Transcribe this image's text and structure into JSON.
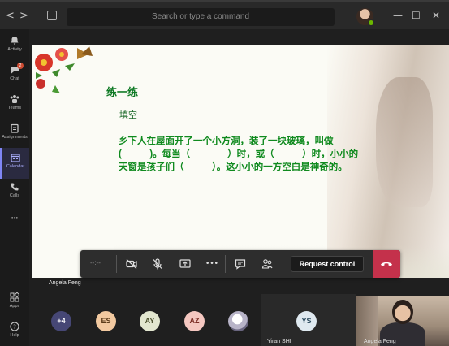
{
  "titlebar": {
    "search_placeholder": "Search or type a command",
    "back_glyph": "<",
    "forward_glyph": ">",
    "minimize_glyph": "—",
    "maximize_glyph": "☐",
    "close_glyph": "✕"
  },
  "rail": {
    "items": [
      {
        "label": "Activity",
        "icon": "bell-icon"
      },
      {
        "label": "Chat",
        "icon": "chat-icon",
        "badge": "2"
      },
      {
        "label": "Teams",
        "icon": "teams-icon"
      },
      {
        "label": "Assignments",
        "icon": "assignments-icon"
      },
      {
        "label": "Calendar",
        "icon": "calendar-icon"
      },
      {
        "label": "Calls",
        "icon": "phone-icon"
      },
      {
        "label": "",
        "icon": "more-icon"
      },
      {
        "label": "Apps",
        "icon": "apps-icon"
      },
      {
        "label": "Help",
        "icon": "help-icon"
      }
    ],
    "more_glyph": "•••"
  },
  "slide": {
    "title": "练一练",
    "subtitle": "填空",
    "body": "乡下人在屋面开了一个小方洞，装了一块玻璃，叫做(　　　)。每当（　　　　）时，或（　　　）时，小小的天窗是孩子们（　　　）。这小小的一方空白是神奇的。"
  },
  "controls": {
    "timer": "--:--",
    "request_control_label": "Request control",
    "more_glyph": "•••"
  },
  "presenter_name": "Angela Feng",
  "participants": {
    "overflow": "+4",
    "avatars": [
      {
        "initials": "ES",
        "color": "#f2c9a0",
        "text_color": "#5a3b1a"
      },
      {
        "initials": "AY",
        "color": "#e2e6cf",
        "text_color": "#4d5230"
      },
      {
        "initials": "AZ",
        "color": "#f4c7c0",
        "text_color": "#7a2e25"
      }
    ],
    "yiran_initials": "YS",
    "yiran_name": "Yiran SHI",
    "video_name": "Angela Feng"
  },
  "colors": {
    "accent": "#7f85f5",
    "hangup": "#c4314b",
    "slide_text_green": "#0f8a1e"
  }
}
